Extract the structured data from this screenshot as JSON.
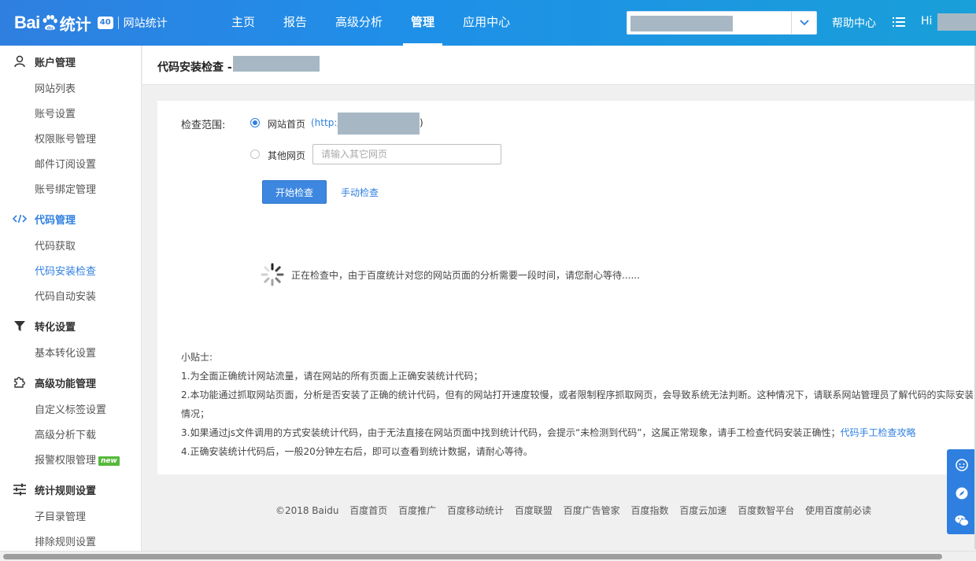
{
  "brand": {
    "logo_text": "Bai",
    "logo_suffix": "统计",
    "version": "40",
    "site_label": "网站统计"
  },
  "nav": [
    {
      "label": "主页"
    },
    {
      "label": "报告"
    },
    {
      "label": "高级分析"
    },
    {
      "label": "管理",
      "active": true
    },
    {
      "label": "应用中心"
    }
  ],
  "header_right": {
    "help": "帮助中心",
    "hi": "Hi"
  },
  "sidebar": {
    "groups": [
      {
        "label": "账户管理",
        "icon": "user-icon",
        "items": [
          "网站列表",
          "账号设置",
          "权限账号管理",
          "邮件订阅设置",
          "账号绑定管理"
        ]
      },
      {
        "label": "代码管理",
        "icon": "code-icon",
        "items": [
          "代码获取",
          "代码安装检查",
          "代码自动安装"
        ]
      },
      {
        "label": "转化设置",
        "icon": "funnel-icon",
        "items": [
          "基本转化设置"
        ]
      },
      {
        "label": "高级功能管理",
        "icon": "puzzle-icon",
        "items": [
          "自定义标签设置",
          "高级分析下载",
          "报警权限管理"
        ]
      },
      {
        "label": "统计规则设置",
        "icon": "sliders-icon",
        "items": [
          "子目录管理",
          "排除规则设置"
        ]
      }
    ],
    "new_badge": "new"
  },
  "page": {
    "title": "代码安装检查 -"
  },
  "check": {
    "scope_label": "检查范围:",
    "option_home": "网站首页",
    "url_prefix": "(http://",
    "url_suffix": ")",
    "option_other": "其他网页",
    "other_placeholder": "请输入其它网页",
    "start_button": "开始检查",
    "manual_link": "手动检查",
    "checking_text": "正在检查中，由于百度统计对您的网站页面的分析需要一段时间，请您耐心等待......"
  },
  "tips": {
    "heading": "小贴士:",
    "line1": "1.为全面正确统计网站流量，请在网站的所有页面上正确安装统计代码；",
    "line2": "2.本功能通过抓取网站页面，分析是否安装了正确的统计代码，但有的网站打开速度较慢，或者限制程序抓取网页，会导致系统无法判断。这种情况下，请联系网站管理员了解代码的实际安装",
    "line2b": "情况；",
    "line3": "3.如果通过js文件调用的方式安装统计代码，由于无法直接在网站页面中找到统计代码，会提示“未检测到代码”，这属正常现象，请手工检查代码安装正确性；",
    "line3_link": "代码手工检查攻略",
    "line4": "4.正确安装统计代码后，一般20分钟左右后，即可以查看到统计数据，请耐心等待。"
  },
  "footer": [
    "©2018 Baidu",
    "百度首页",
    "百度推广",
    "百度移动统计",
    "百度联盟",
    "百度广告管家",
    "百度指数",
    "百度云加速",
    "百度数智平台",
    "使用百度前必读"
  ]
}
